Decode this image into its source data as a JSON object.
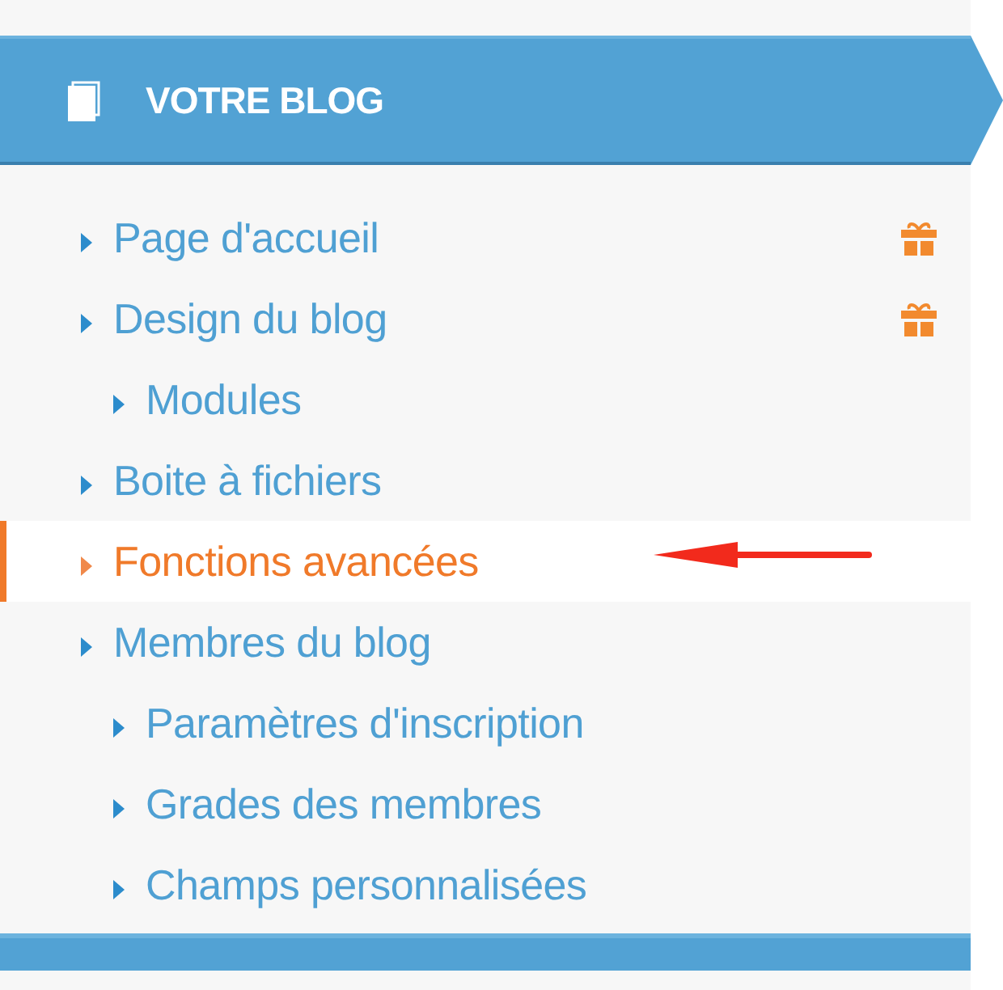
{
  "header": {
    "title": "VOTRE BLOG"
  },
  "menu": [
    {
      "label": "Page d'accueil",
      "selected": false,
      "gift": true
    },
    {
      "label": "Design du blog",
      "selected": false,
      "gift": true,
      "children": [
        {
          "label": "Modules",
          "selected": false,
          "gift": false
        }
      ]
    },
    {
      "label": "Boite à fichiers",
      "selected": false,
      "gift": false
    },
    {
      "label": "Fonctions avancées",
      "selected": true,
      "gift": false,
      "annotation_arrow": true
    },
    {
      "label": "Membres du blog",
      "selected": false,
      "gift": false,
      "children": [
        {
          "label": "Paramètres d'inscription",
          "selected": false,
          "gift": false
        },
        {
          "label": "Grades des membres",
          "selected": false,
          "gift": false
        },
        {
          "label": "Champs personnalisées",
          "selected": false,
          "gift": false
        }
      ]
    }
  ]
}
